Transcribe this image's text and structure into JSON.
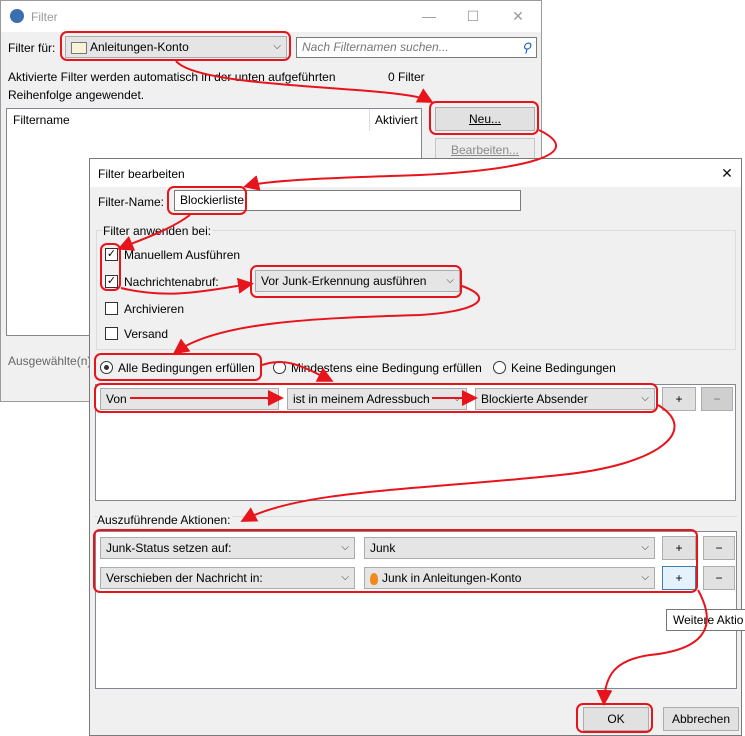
{
  "bg_window": {
    "title": "Filter",
    "filter_for_label": "Filter für:",
    "account": "Anleitungen-Konto",
    "search_placeholder": "Nach Filternamen suchen...",
    "info_text_1": "Aktivierte Filter werden automatisch in der unten aufgeführten",
    "info_text_2": "Reihenfolge angewendet.",
    "filter_count": "0 Filter",
    "col_name": "Filtername",
    "col_active": "Aktiviert",
    "new_button": "Neu...",
    "edit_button": "Bearbeiten...",
    "selected_label": "Ausgewählte(n)"
  },
  "dialog": {
    "title": "Filter bearbeiten",
    "filter_name_label": "Filter-Name:",
    "filter_name_value": "Blockierliste",
    "apply_group_label": "Filter anwenden bei:",
    "manual_label": "Manuellem Ausführen",
    "manual_checked": true,
    "fetch_label": "Nachrichtenabruf:",
    "fetch_checked": true,
    "fetch_option": "Vor Junk-Erkennung ausführen",
    "archive_label": "Archivieren",
    "archive_checked": false,
    "send_label": "Versand",
    "send_checked": false,
    "match_all": "Alle Bedingungen erfüllen",
    "match_any": "Mindestens eine Bedingung erfüllen",
    "match_none": "Keine Bedingungen",
    "match_selected": "all",
    "condition": {
      "field": "Von",
      "operator": "ist in meinem Adressbuch",
      "value": "Blockierte Absender",
      "plus": "+",
      "minus": "−"
    },
    "actions_label": "Auszuführende Aktionen:",
    "actions": [
      {
        "action": "Junk-Status setzen auf:",
        "value": "Junk",
        "plus": "+",
        "minus": "−"
      },
      {
        "action": "Verschieben der Nachricht in:",
        "value": "Junk in Anleitungen-Konto",
        "plus": "+",
        "minus": "−"
      }
    ],
    "tooltip": "Weitere Aktio",
    "ok_button": "OK",
    "cancel_button": "Abbrechen"
  },
  "colors": {
    "annotation_red": "#e8141c",
    "dialog_bg": "#f0f0f0"
  }
}
